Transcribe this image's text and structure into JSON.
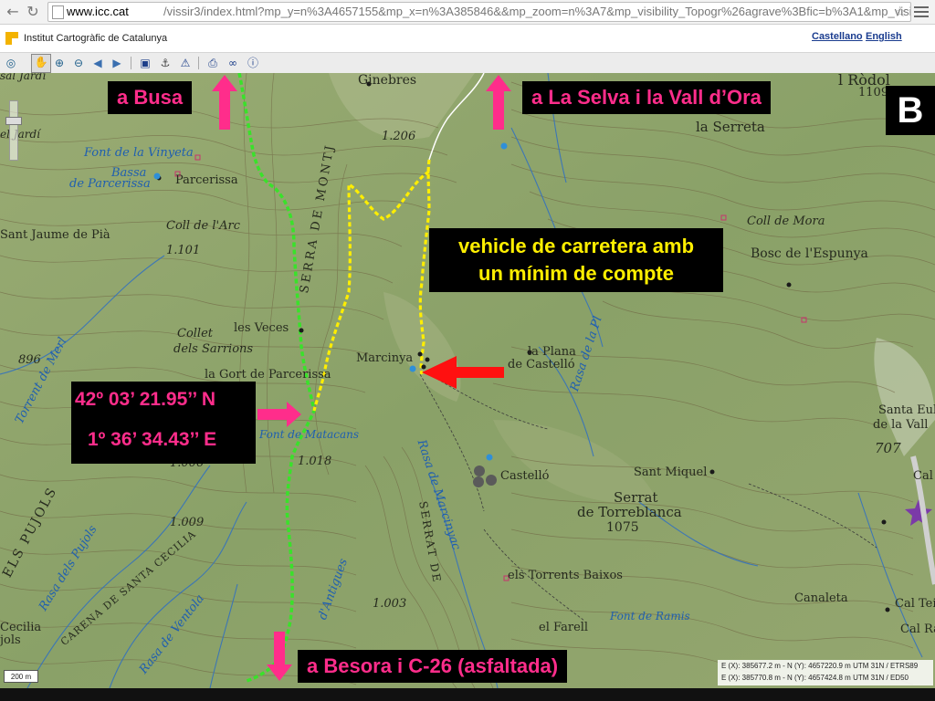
{
  "browser": {
    "url_host": "www.icc.cat",
    "url_rest": "/vissir3/index.html?mp_y=n%3A4657155&mp_x=n%3A385846&&mp_zoom=n%3A7&mp_visibility_Topogr%26agrave%3Bfic=b%3A1&mp_visibility_Ortofo"
  },
  "header": {
    "org_name": "Institut Cartogràfic de Catalunya",
    "lang_castellano": "Castellano",
    "lang_english": "English",
    "logo_color": "#f3b300"
  },
  "toolbar": {
    "icons": [
      "zoom-extent-icon",
      "pan-hand-icon",
      "zoom-in-icon",
      "zoom-out-icon",
      "back-icon",
      "forward-icon",
      "save-icon",
      "anchor-icon",
      "warning-icon",
      "print-icon",
      "link-icon",
      "help-icon"
    ]
  },
  "annotations": {
    "busa": "a Busa",
    "selva": "a La Selva i la Vall d’Ora",
    "letter": "B",
    "vehicle_line1": "vehicle de carretera amb",
    "vehicle_line2": "un mínim de compte",
    "lat": "42º 03’ 21.95’’ N",
    "lon": "1º 36’ 34.43’’ E",
    "besora": "a Besora i C-26 (asfaltada)"
  },
  "map_labels": {
    "ginebres": "Ginebres",
    "rodol": "l Ròdol",
    "rodol_elev": "1109",
    "serreta": "la Serreta",
    "font_vinyeta": "Font de la Vinyeta",
    "bassa": "Bassa",
    "de_parcerissa": "de Parcerissa",
    "parcerissa": "Parcerissa",
    "coll_arc": "Coll de l'Arc",
    "sant_jaume": "Sant Jaume de Pià",
    "coll_mora": "Coll de Mora",
    "bosc_espunya": "Bosc de l'Espunya",
    "elev_1206": "1.206",
    "elev_1101": "1.101",
    "les_veces": "les Veces",
    "collet": "Collet",
    "dels_sarrions": "dels Sarrions",
    "marcinya": "Marcinya",
    "la_plana": "la Plana",
    "de_castello": "de Castelló",
    "elev_896": "896",
    "gort_parcerissa": "la Gort de Parcerissa",
    "font_matacans": "Font de Matacans",
    "elev_1018": "1.018",
    "castello": "Castelló",
    "sant_miquel": "Sant Miquel",
    "serrat": "Serrat",
    "de_torreblanca": "de Torreblanca",
    "elev_1075": "1075",
    "elev_1006": "1.006",
    "elev_1009": "1.009",
    "els_pujols": "ELS PUJOLS",
    "rasa_pujols": "Rasa dels Pujols",
    "carena_cecilia": "CARENA DE SANTA CECILIA",
    "cecilia": "Cecilia",
    "jols": "jols",
    "rasa_ventola": "Rasa de Ventola",
    "rasa_antigues": "d'Antigues",
    "rasa_marcinyac": "Rasa de Marcinyac",
    "serrat_de": "SERRAT DE",
    "els_torrents": "els Torrents Baixos",
    "elev_1003": "1.003",
    "el_farell": "el Farell",
    "font_ramis": "Font de Ramis",
    "canaleta": "Canaleta",
    "cal_tei": "Cal Tei",
    "cal_ra": "Cal Ra",
    "cal": "Cal",
    "santa_eul": "Santa Eul",
    "de_la_vall": "de la Vall",
    "elev_707": "707",
    "serra_montj": "SERRA DE MONTJ",
    "torrent_merl": "Torrent de Merl",
    "rasa_la_pl": "Rasa de la Pl",
    "sal_jardi": "sal Jardí",
    "el_jardi": "el Jardí"
  },
  "utm": {
    "line1": "E (X): 385677.2 m - N (Y): 4657220.9 m  UTM 31N / ETRS89",
    "line2": "E (X): 385770.8 m - N (Y): 4657424.8 m  UTM 31N / ED50"
  },
  "scale_label": "200 m",
  "colors": {
    "callout_text": "#ff2d8b",
    "callout_yellow": "#ffef00",
    "route_green": "#39e22a",
    "route_yellow": "#ffee00",
    "arrow_red": "#ff1010",
    "arrow_pink": "#ff2d8b"
  }
}
